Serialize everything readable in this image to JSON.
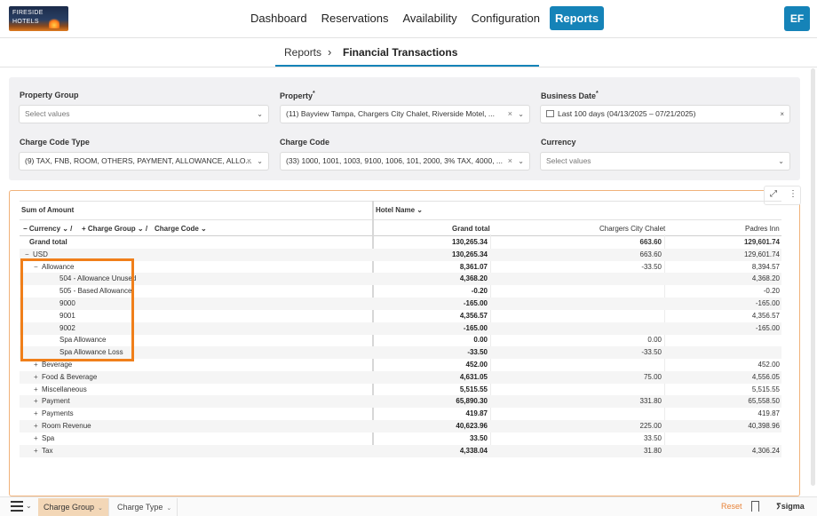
{
  "logo": {
    "line1": "FIRESIDE",
    "line2": "HOTELS"
  },
  "nav": {
    "items": [
      "Dashboard",
      "Reservations",
      "Availability",
      "Configuration"
    ],
    "active": "Reports",
    "avatar": "EF"
  },
  "breadcrumb": {
    "root": "Reports",
    "sep": "›",
    "current": "Financial Transactions"
  },
  "filters": {
    "property_group": {
      "label": "Property Group",
      "placeholder": "Select values"
    },
    "property": {
      "label": "Property",
      "required": "*",
      "value": "(11) Bayview Tampa, Chargers City Chalet, Riverside Motel, ..."
    },
    "business_date": {
      "label": "Business Date",
      "required": "*",
      "value": "Last 100 days (04/13/2025 – 07/21/2025)"
    },
    "charge_code_type": {
      "label": "Charge Code Type",
      "value": "(9) TAX, FNB, ROOM, OTHERS, PAYMENT, ALLOWANCE, ALLO..."
    },
    "charge_code": {
      "label": "Charge Code",
      "value": "(33) 1000, 1001, 1003, 9100, 1006, 101, 2000, 3% TAX, 4000, ..."
    },
    "currency": {
      "label": "Currency",
      "placeholder": "Select values"
    }
  },
  "pivot": {
    "value_label": "Sum of Amount",
    "col_field": "Hotel Name",
    "row_fields": [
      "Currency",
      "Charge Group",
      "Charge Code"
    ],
    "columns": [
      "Grand total",
      "Chargers City Chalet",
      "Padres Inn"
    ],
    "rows": [
      {
        "label": "Grand total",
        "bold": true,
        "toggle": "",
        "gt": "130,265.34",
        "ccc": "663.60",
        "pi": "129,601.74"
      },
      {
        "label": "USD",
        "bold": false,
        "toggle": "−",
        "gt": "130,265.34",
        "ccc": "663.60",
        "pi": "129,601.74"
      },
      {
        "label": "Allowance",
        "bold": false,
        "toggle": "−",
        "gt": "8,361.07",
        "ccc": "-33.50",
        "pi": "8,394.57"
      },
      {
        "label": "504 - Allowance Unused",
        "bold": false,
        "toggle": "",
        "gt": "4,368.20",
        "ccc": "",
        "pi": "4,368.20"
      },
      {
        "label": "505 - Based Allowance",
        "bold": false,
        "toggle": "",
        "gt": "-0.20",
        "ccc": "",
        "pi": "-0.20"
      },
      {
        "label": "9000",
        "bold": false,
        "toggle": "",
        "gt": "-165.00",
        "ccc": "",
        "pi": "-165.00"
      },
      {
        "label": "9001",
        "bold": false,
        "toggle": "",
        "gt": "4,356.57",
        "ccc": "",
        "pi": "4,356.57"
      },
      {
        "label": "9002",
        "bold": false,
        "toggle": "",
        "gt": "-165.00",
        "ccc": "",
        "pi": "-165.00"
      },
      {
        "label": "Spa Allowance",
        "bold": false,
        "toggle": "",
        "gt": "0.00",
        "ccc": "0.00",
        "pi": ""
      },
      {
        "label": "Spa Allowance Loss",
        "bold": false,
        "toggle": "",
        "gt": "-33.50",
        "ccc": "-33.50",
        "pi": ""
      },
      {
        "label": "Beverage",
        "bold": false,
        "toggle": "+",
        "gt": "452.00",
        "ccc": "",
        "pi": "452.00"
      },
      {
        "label": "Food & Beverage",
        "bold": false,
        "toggle": "+",
        "gt": "4,631.05",
        "ccc": "75.00",
        "pi": "4,556.05"
      },
      {
        "label": "Miscellaneous",
        "bold": false,
        "toggle": "+",
        "gt": "5,515.55",
        "ccc": "",
        "pi": "5,515.55"
      },
      {
        "label": "Payment",
        "bold": false,
        "toggle": "+",
        "gt": "65,890.30",
        "ccc": "331.80",
        "pi": "65,558.50"
      },
      {
        "label": "Payments",
        "bold": false,
        "toggle": "+",
        "gt": "419.87",
        "ccc": "",
        "pi": "419.87"
      },
      {
        "label": "Room Revenue",
        "bold": false,
        "toggle": "+",
        "gt": "40,623.96",
        "ccc": "225.00",
        "pi": "40,398.96"
      },
      {
        "label": "Spa",
        "bold": false,
        "toggle": "+",
        "gt": "33.50",
        "ccc": "33.50",
        "pi": ""
      },
      {
        "label": "Tax",
        "bold": false,
        "toggle": "+",
        "gt": "4,338.04",
        "ccc": "31.80",
        "pi": "4,306.24"
      }
    ]
  },
  "bottom": {
    "tabs": [
      "Charge Group",
      "Charge Type"
    ],
    "reset": "Reset",
    "brand": "sigma"
  },
  "colors": {
    "accent": "#1583b8",
    "highlight": "#f07f1a",
    "active_tab": "#f3d7b7"
  }
}
